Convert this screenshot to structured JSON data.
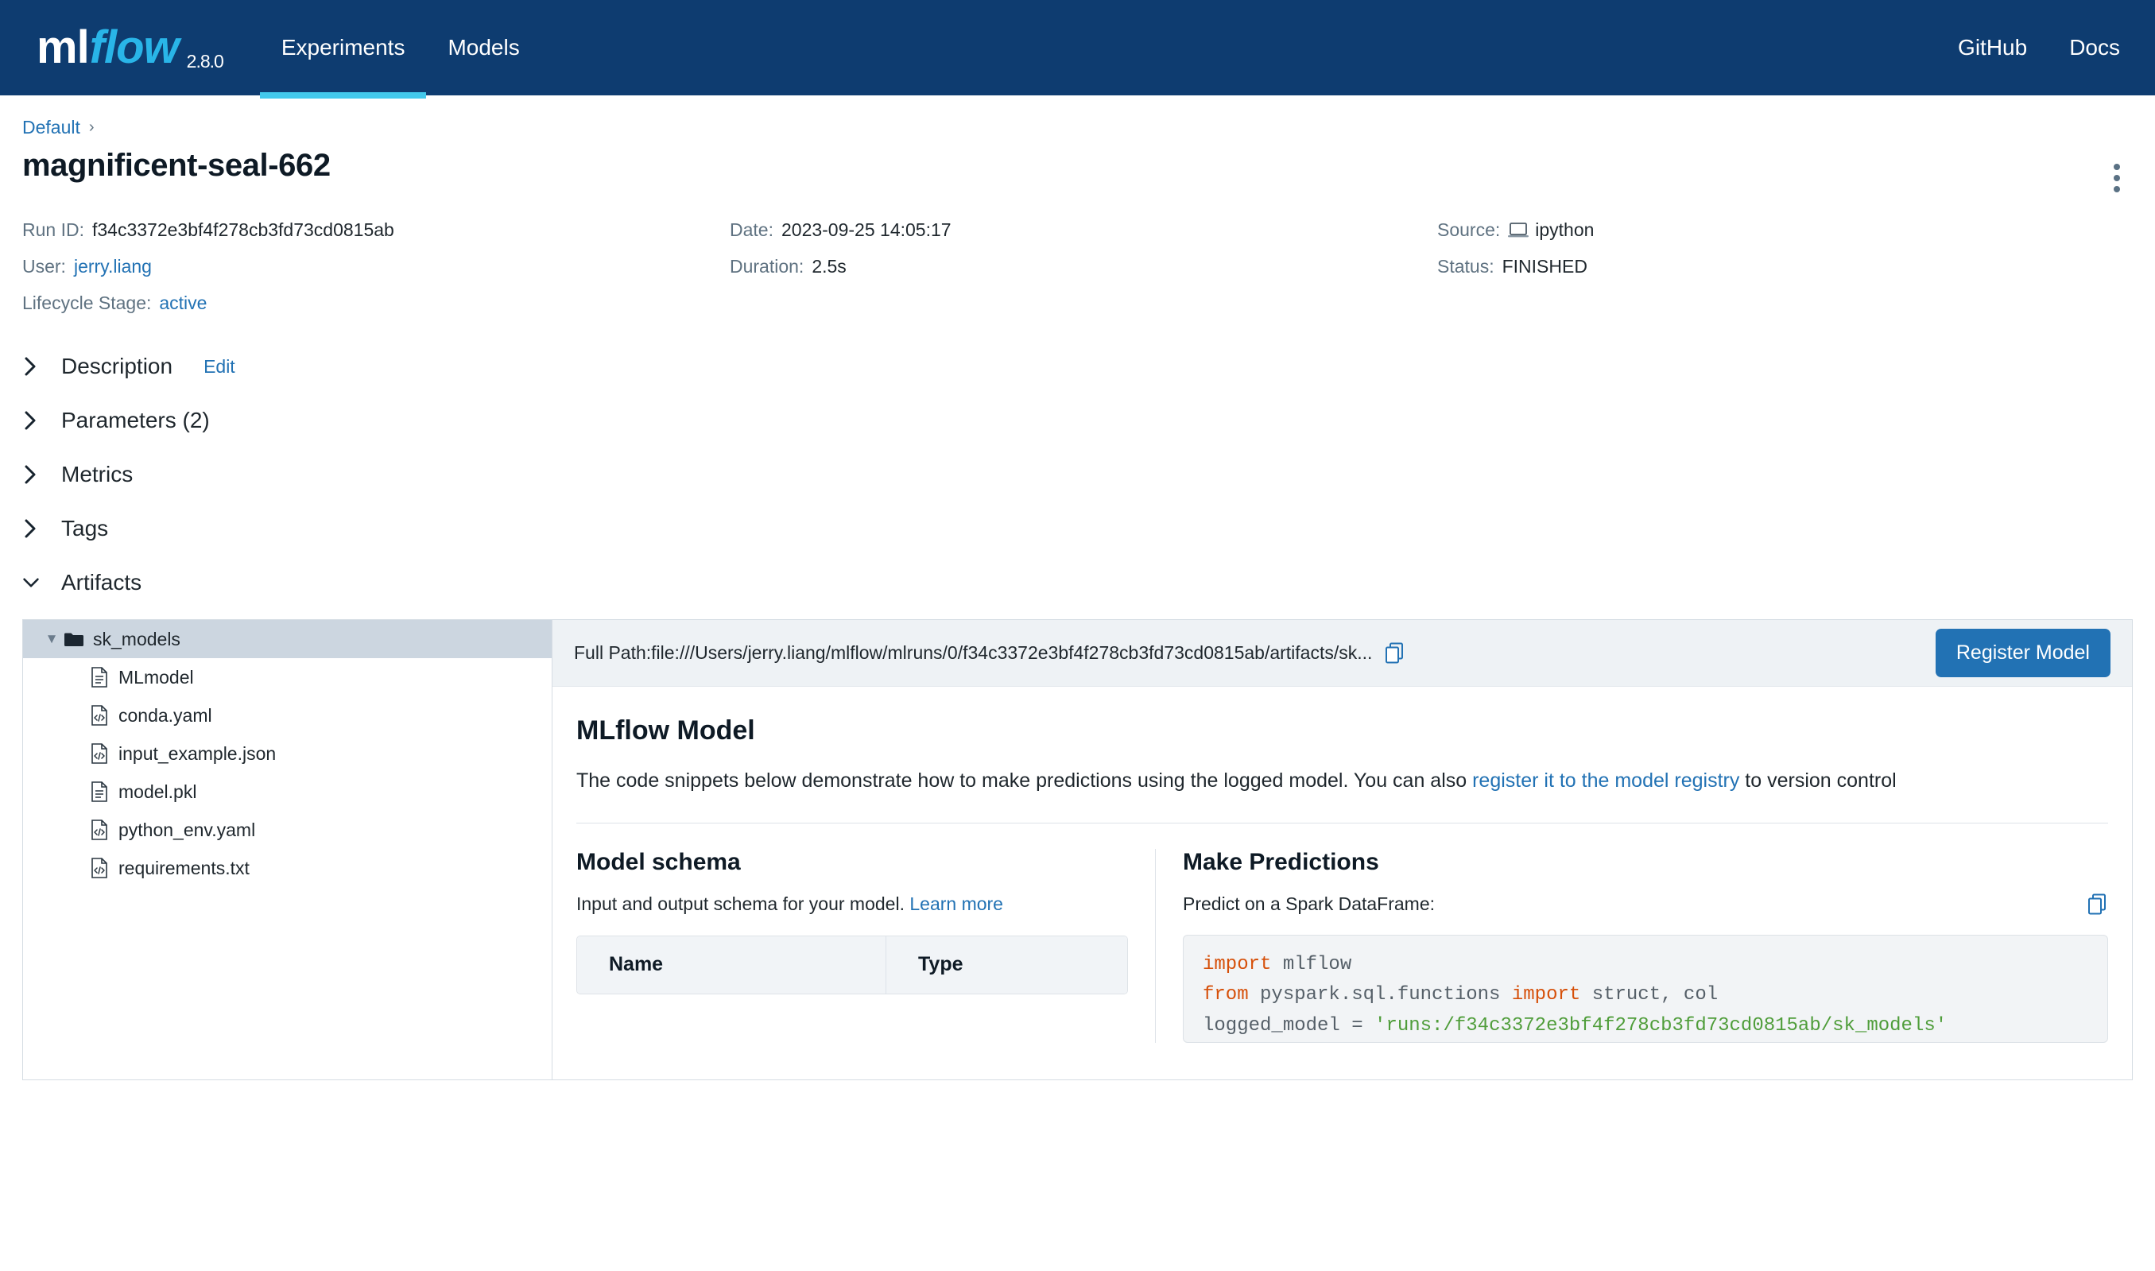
{
  "navbar": {
    "logo_ml": "ml",
    "logo_flow": "flow",
    "version": "2.8.0",
    "tabs": [
      {
        "label": "Experiments",
        "active": true
      },
      {
        "label": "Models",
        "active": false
      }
    ],
    "right_links": [
      {
        "label": "GitHub"
      },
      {
        "label": "Docs"
      }
    ]
  },
  "breadcrumb": {
    "parent": "Default",
    "separator": "›"
  },
  "run": {
    "title": "magnificent-seal-662",
    "overflow_menu_icon": "kebab-menu-icon",
    "fields": {
      "run_id_label": "Run ID:",
      "run_id_value": "f34c3372e3bf4f278cb3fd73cd0815ab",
      "date_label": "Date:",
      "date_value": "2023-09-25 14:05:17",
      "source_label": "Source:",
      "source_value": "ipython",
      "source_icon": "laptop-icon",
      "user_label": "User:",
      "user_value": "jerry.liang",
      "duration_label": "Duration:",
      "duration_value": "2.5s",
      "status_label": "Status:",
      "status_value": "FINISHED",
      "lifecycle_label": "Lifecycle Stage:",
      "lifecycle_value": "active"
    }
  },
  "sections": [
    {
      "title": "Description",
      "expanded": false,
      "edit_label": "Edit"
    },
    {
      "title": "Parameters (2)",
      "expanded": false
    },
    {
      "title": "Metrics",
      "expanded": false
    },
    {
      "title": "Tags",
      "expanded": false
    },
    {
      "title": "Artifacts",
      "expanded": true
    }
  ],
  "artifacts": {
    "tree": [
      {
        "label": "sk_models",
        "type": "folder",
        "selected": true,
        "expanded": true,
        "depth": 0
      },
      {
        "label": "MLmodel",
        "type": "file",
        "selected": false,
        "depth": 1
      },
      {
        "label": "conda.yaml",
        "type": "code",
        "selected": false,
        "depth": 1
      },
      {
        "label": "input_example.json",
        "type": "code",
        "selected": false,
        "depth": 1
      },
      {
        "label": "model.pkl",
        "type": "file",
        "selected": false,
        "depth": 1
      },
      {
        "label": "python_env.yaml",
        "type": "code",
        "selected": false,
        "depth": 1
      },
      {
        "label": "requirements.txt",
        "type": "code",
        "selected": false,
        "depth": 1
      }
    ],
    "path_bar": {
      "text": "Full Path:file:///Users/jerry.liang/mlflow/mlruns/0/f34c3372e3bf4f278cb3fd73cd0815ab/artifacts/sk...",
      "copy_icon": "copy-icon"
    },
    "register_button": "Register Model"
  },
  "model": {
    "heading": "MLflow Model",
    "description_before": "The code snippets below demonstrate how to make predictions using the logged model. You can also ",
    "description_link": "register it to the model registry",
    "description_after": " to version control",
    "schema": {
      "heading": "Model schema",
      "subtitle": "Input and output schema for your model. ",
      "learn_more": "Learn more",
      "columns": [
        "Name",
        "Type"
      ],
      "rows": []
    },
    "predictions": {
      "heading": "Make Predictions",
      "label": "Predict on a Spark DataFrame:",
      "copy_icon": "copy-icon",
      "code_lines": [
        {
          "tokens": [
            {
              "t": "import",
              "c": "kw"
            },
            {
              "t": " mlflow",
              "c": "plain"
            }
          ]
        },
        {
          "tokens": [
            {
              "t": "from",
              "c": "kw"
            },
            {
              "t": " pyspark.sql.functions ",
              "c": "plain"
            },
            {
              "t": "import",
              "c": "kw"
            },
            {
              "t": " struct, col",
              "c": "plain"
            }
          ]
        },
        {
          "tokens": [
            {
              "t": "logged_model = ",
              "c": "plain"
            },
            {
              "t": "'runs:/f34c3372e3bf4f278cb3fd73cd0815ab/sk_models'",
              "c": "str"
            }
          ]
        }
      ]
    }
  }
}
